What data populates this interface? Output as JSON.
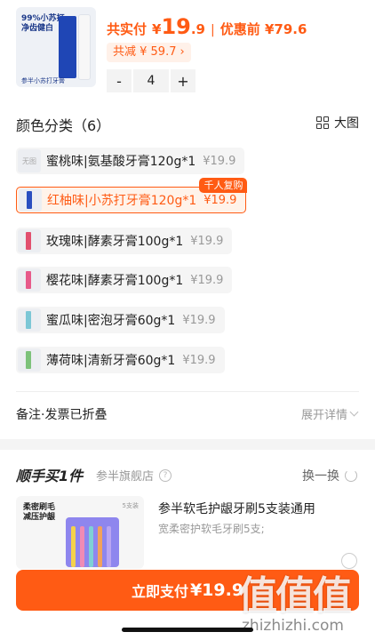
{
  "product": {
    "thumb_text_line1": "99%小苏打",
    "thumb_text_line2": "净齿健白",
    "thumb_caption": "参半小苏打牙膏",
    "price_label": "共实付",
    "price_yen": "¥",
    "price_main": "19",
    "price_dec": ".9",
    "separator": "|",
    "pre_discount": "优惠前 ¥79.6",
    "discount": "共减 ¥ 59.7",
    "discount_chevron": "›",
    "quantity": "4",
    "minus": "-",
    "plus": "+"
  },
  "color_section": {
    "title": "颜色分类（6）",
    "view_label": "大图",
    "options": [
      {
        "label": "蜜桃味|氨基酸牙膏120g*1",
        "price": "¥19.9",
        "swatch_text": "无图",
        "selected": false
      },
      {
        "label": "红柚味|小苏打牙膏120g*1",
        "price": "¥19.9",
        "badge": "千人复购",
        "selected": true
      },
      {
        "label": "玫瑰味|酵素牙膏100g*1",
        "price": "¥19.9",
        "selected": false
      },
      {
        "label": "樱花味|酵素牙膏100g*1",
        "price": "¥19.9",
        "selected": false
      },
      {
        "label": "蜜瓜味|密泡牙膏60g*1",
        "price": "¥19.9",
        "selected": false
      },
      {
        "label": "薄荷味|清新牙膏60g*1",
        "price": "¥19.9",
        "selected": false
      }
    ],
    "swatch_colors": [
      "#eceef2",
      "#2a4fc0",
      "#e2506f",
      "#e75a8a",
      "#7cc7d6",
      "#7dc27a"
    ]
  },
  "remark": {
    "label": "备注·发票已折叠",
    "expand": "展开详情"
  },
  "upsell": {
    "title": "顺手买1件",
    "store": "参半旗舰店",
    "help": "?",
    "swap": "换一换",
    "image_line1": "柔密刷毛",
    "image_line2": "减压护龈",
    "image_count": "5支装",
    "name": "参半软毛护龈牙刷5支装通用",
    "desc": "宽柔密护软毛牙刷5支;",
    "brush_colors": [
      "#f4d24c",
      "#f08bb5",
      "#7ed0d6",
      "#f2a25b",
      "#b9a6f2"
    ]
  },
  "footer": {
    "pay_label": "立即支付",
    "pay_amount": "¥19.9"
  },
  "watermark": {
    "glyphs": "值值值",
    "url": "zhizhizhi.com"
  },
  "colors": {
    "accent": "#ff5b14",
    "accent_light": "#fff3ea",
    "muted": "#999999"
  }
}
